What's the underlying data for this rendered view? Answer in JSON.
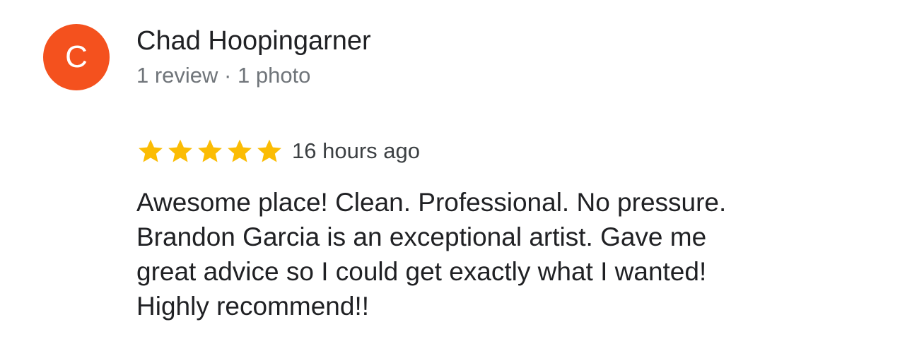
{
  "reviewer": {
    "initial": "C",
    "avatar_color": "#f4511e",
    "name": "Chad Hoopingarner",
    "meta": "1 review · 1 photo"
  },
  "rating": {
    "stars": 5,
    "max_stars": 5,
    "star_color": "#fbbc04",
    "icon": "star-icon",
    "time_ago": "16 hours ago"
  },
  "review": {
    "lines": [
      "Awesome place! Clean. Professional. No pressure.",
      "Brandon Garcia is an exceptional artist. Gave me",
      "great advice so I could get exactly what I wanted!",
      "Highly recommend!!"
    ]
  }
}
